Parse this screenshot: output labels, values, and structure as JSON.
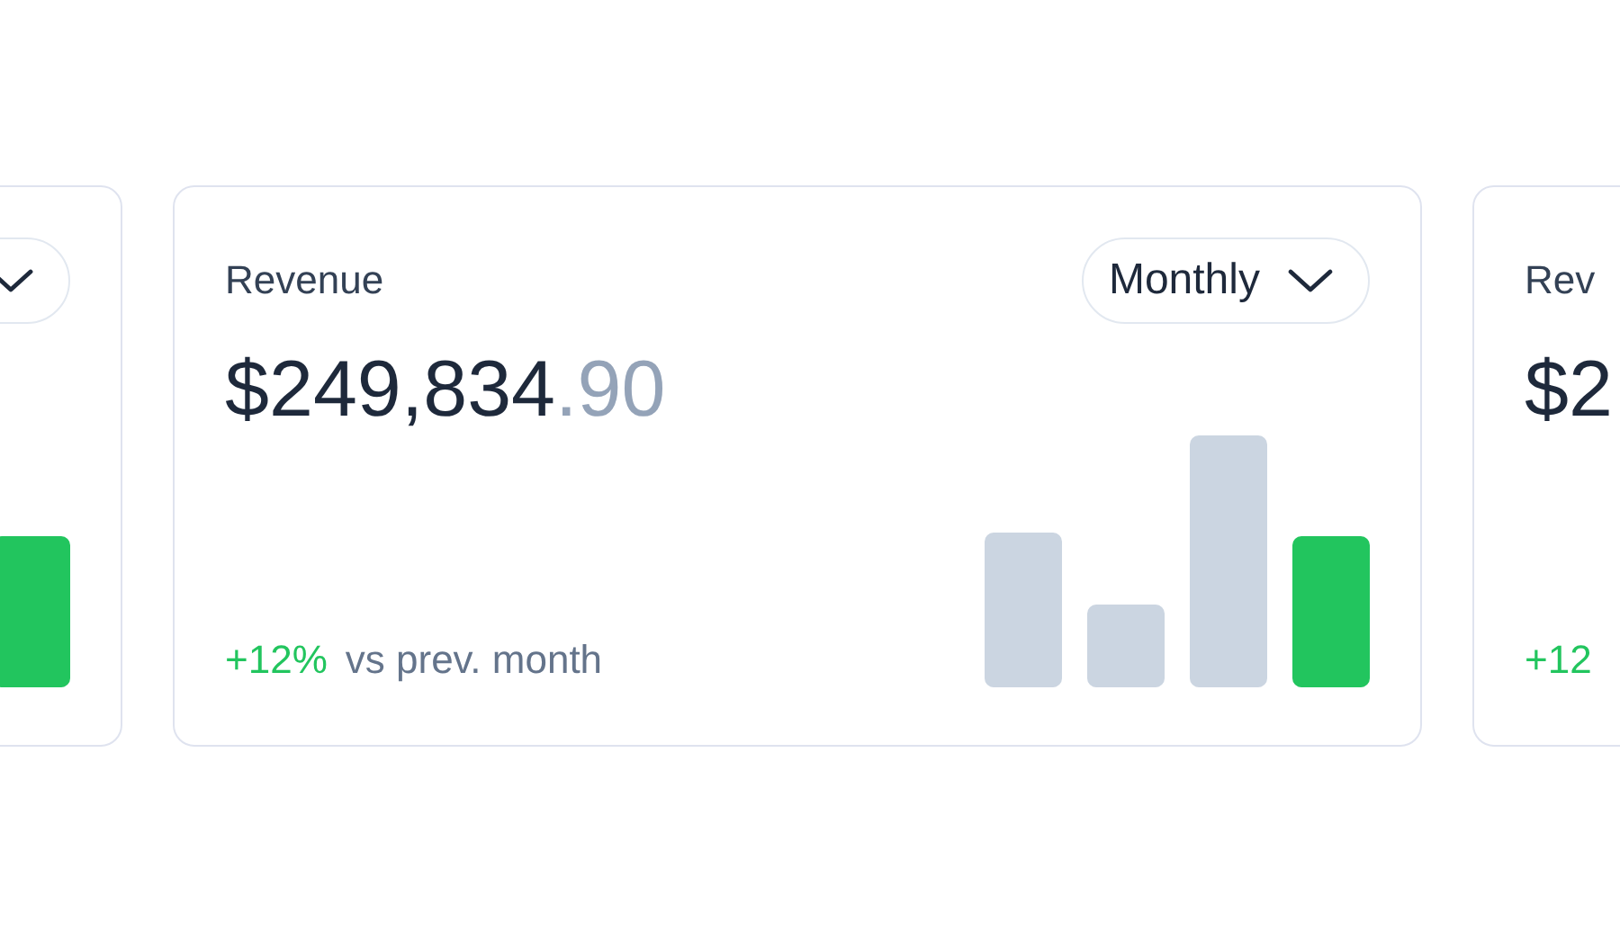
{
  "cards": [
    {
      "kind": "peek-left",
      "dropdown_visible": true
    },
    {
      "kind": "full",
      "label": "Revenue",
      "period": {
        "label": "Monthly"
      },
      "amount": "$249,834",
      "cents": ".90",
      "change": "+12%",
      "comparison": "vs prev. month"
    },
    {
      "kind": "peek-right",
      "label": "Rev",
      "amount": "$2",
      "change": "+12"
    }
  ]
}
